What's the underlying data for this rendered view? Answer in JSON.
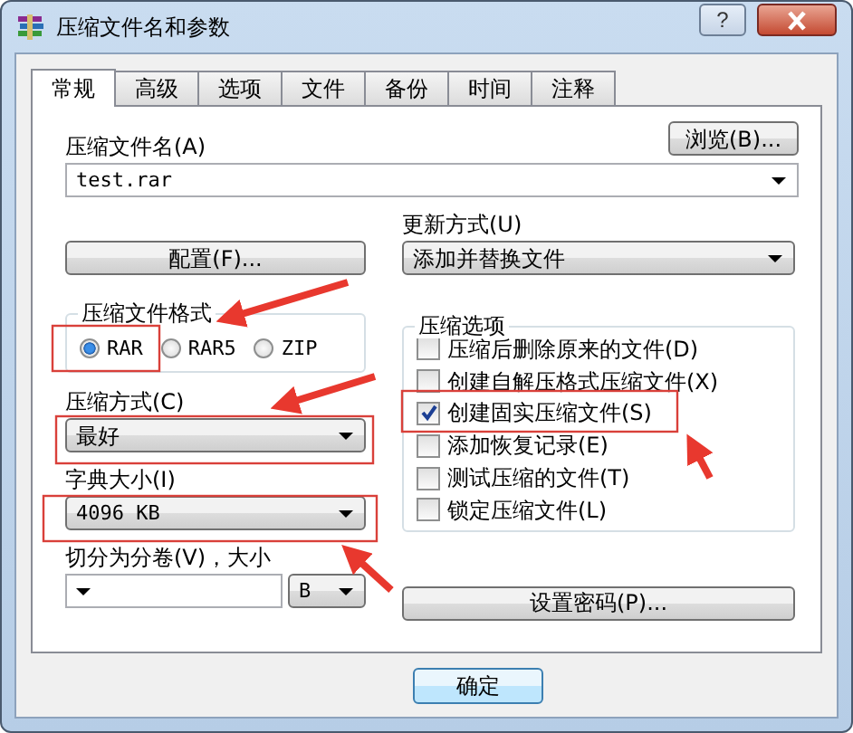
{
  "window": {
    "title": "压缩文件名和参数",
    "help_button": "?"
  },
  "tabs": [
    {
      "label": "常规",
      "selected": true
    },
    {
      "label": "高级",
      "selected": false
    },
    {
      "label": "选项",
      "selected": false
    },
    {
      "label": "文件",
      "selected": false
    },
    {
      "label": "备份",
      "selected": false
    },
    {
      "label": "时间",
      "selected": false
    },
    {
      "label": "注释",
      "selected": false
    }
  ],
  "archive_name": {
    "label": "压缩文件名(A)",
    "value": "test.rar"
  },
  "browse_button": "浏览(B)...",
  "profiles_button": "配置(F)...",
  "update_mode": {
    "label": "更新方式(U)",
    "value": "添加并替换文件"
  },
  "archive_format": {
    "label": "压缩文件格式",
    "options": [
      {
        "label": "RAR",
        "selected": true
      },
      {
        "label": "RAR5",
        "selected": false
      },
      {
        "label": "ZIP",
        "selected": false
      }
    ]
  },
  "compression_method": {
    "label": "压缩方式(C)",
    "value": "最好"
  },
  "dictionary_size": {
    "label": "字典大小(I)",
    "value": "4096 KB"
  },
  "split_volumes": {
    "label": "切分为分卷(V)，大小",
    "unit": "B"
  },
  "archiving_options": {
    "label": "压缩选项",
    "items": [
      {
        "label": "压缩后删除原来的文件(D)",
        "checked": false
      },
      {
        "label": "创建自解压格式压缩文件(X)",
        "checked": false
      },
      {
        "label": "创建固实压缩文件(S)",
        "checked": true
      },
      {
        "label": "添加恢复记录(E)",
        "checked": false
      },
      {
        "label": "测试压缩的文件(T)",
        "checked": false
      },
      {
        "label": "锁定压缩文件(L)",
        "checked": false
      }
    ]
  },
  "password_button": "设置密码(P)...",
  "buttons": [
    "确定"
  ]
}
